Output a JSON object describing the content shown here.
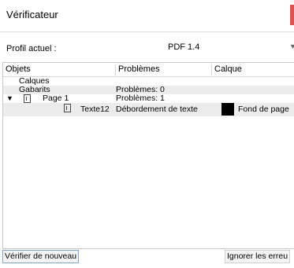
{
  "window": {
    "title": "Vérificateur",
    "accent": "#d9534f"
  },
  "profile": {
    "label": "Profil actuel :",
    "value": "PDF 1.4"
  },
  "table": {
    "headers": {
      "objects": "Objets",
      "problems": "Problèmes",
      "layer": "Calque"
    },
    "rows": [
      {
        "object": "Calques",
        "problems": "",
        "layer": ""
      },
      {
        "object": "Gabarits",
        "problems": "Problèmes: 0",
        "layer": ""
      },
      {
        "object": "Page 1",
        "problems": "Problèmes: 1",
        "layer": ""
      },
      {
        "object": "Texte12",
        "problems": "Débordement de texte",
        "layer": "Fond de page",
        "layer_color": "#000000"
      }
    ]
  },
  "buttons": {
    "check_again": "Vérifier de nouveau",
    "ignore_errors": "Ignorer les erreu"
  }
}
